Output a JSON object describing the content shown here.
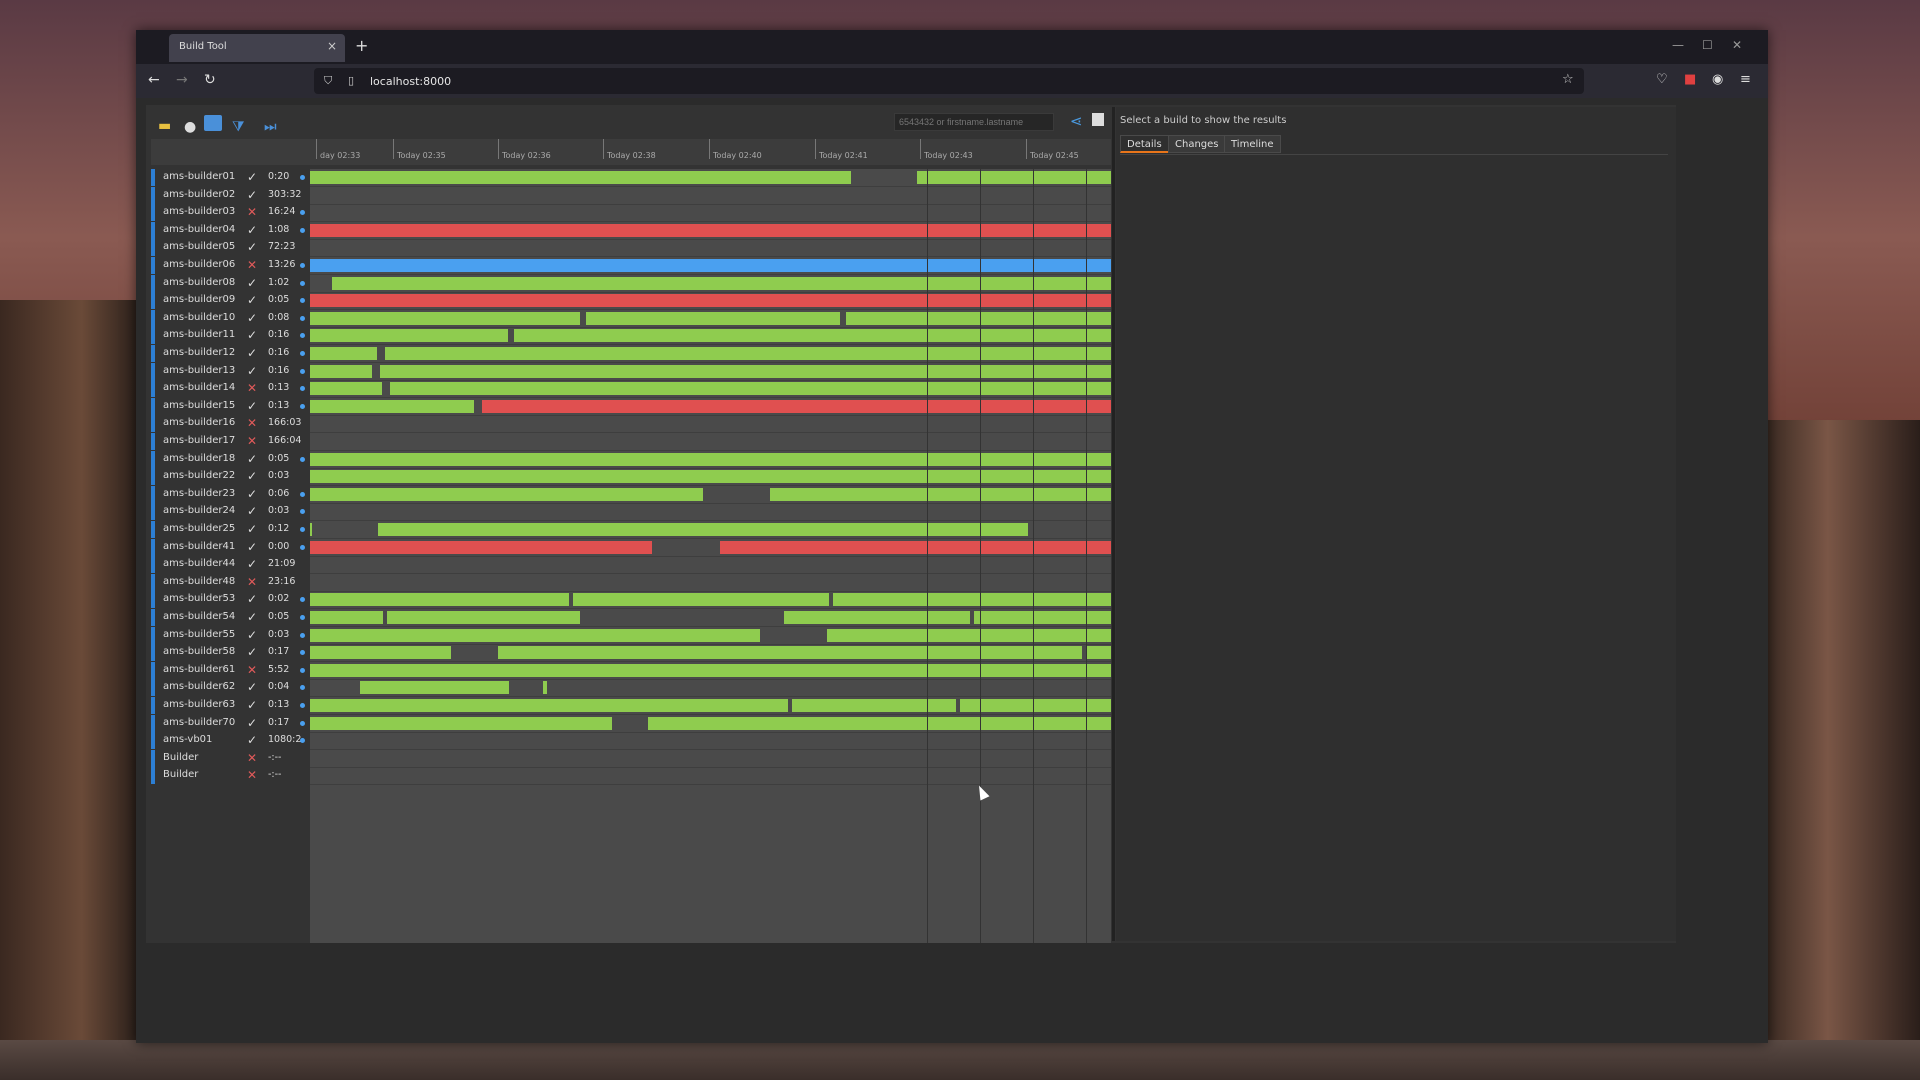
{
  "browser": {
    "tab_title": "Build Tool",
    "tab_close": "×",
    "new_tab": "+",
    "url": "localhost:8000",
    "back": "←",
    "forward": "→",
    "reload": "↻",
    "minimize": "—",
    "maximize": "☐",
    "close": "✕"
  },
  "toolbar": {
    "search_placeholder": "6543432 or firstname.lastname"
  },
  "timeline": {
    "ticks": [
      "day 02:33",
      "Today 02:35",
      "Today 02:36",
      "Today 02:38",
      "Today 02:40",
      "Today 02:41",
      "Today 02:43",
      "Today 02:45"
    ]
  },
  "builders": [
    {
      "name": "ams-builder01",
      "status": "ok",
      "time": "0:20",
      "dot": true
    },
    {
      "name": "ams-builder02",
      "status": "ok",
      "time": "303:32",
      "dot": false
    },
    {
      "name": "ams-builder03",
      "status": "fail",
      "time": "16:24",
      "dot": true
    },
    {
      "name": "ams-builder04",
      "status": "ok",
      "time": "1:08",
      "dot": true
    },
    {
      "name": "ams-builder05",
      "status": "ok",
      "time": "72:23",
      "dot": false
    },
    {
      "name": "ams-builder06",
      "status": "fail",
      "time": "13:26",
      "dot": true
    },
    {
      "name": "ams-builder08",
      "status": "ok",
      "time": "1:02",
      "dot": true
    },
    {
      "name": "ams-builder09",
      "status": "ok",
      "time": "0:05",
      "dot": true
    },
    {
      "name": "ams-builder10",
      "status": "ok",
      "time": "0:08",
      "dot": true
    },
    {
      "name": "ams-builder11",
      "status": "ok",
      "time": "0:16",
      "dot": true
    },
    {
      "name": "ams-builder12",
      "status": "ok",
      "time": "0:16",
      "dot": true
    },
    {
      "name": "ams-builder13",
      "status": "ok",
      "time": "0:16",
      "dot": true
    },
    {
      "name": "ams-builder14",
      "status": "fail",
      "time": "0:13",
      "dot": true
    },
    {
      "name": "ams-builder15",
      "status": "ok",
      "time": "0:13",
      "dot": true
    },
    {
      "name": "ams-builder16",
      "status": "fail",
      "time": "166:03",
      "dot": false
    },
    {
      "name": "ams-builder17",
      "status": "fail",
      "time": "166:04",
      "dot": false
    },
    {
      "name": "ams-builder18",
      "status": "ok",
      "time": "0:05",
      "dot": true
    },
    {
      "name": "ams-builder22",
      "status": "ok",
      "time": "0:03",
      "dot": false
    },
    {
      "name": "ams-builder23",
      "status": "ok",
      "time": "0:06",
      "dot": true
    },
    {
      "name": "ams-builder24",
      "status": "ok",
      "time": "0:03",
      "dot": true
    },
    {
      "name": "ams-builder25",
      "status": "ok",
      "time": "0:12",
      "dot": true
    },
    {
      "name": "ams-builder41",
      "status": "ok",
      "time": "0:00",
      "dot": true
    },
    {
      "name": "ams-builder44",
      "status": "ok",
      "time": "21:09",
      "dot": false
    },
    {
      "name": "ams-builder48",
      "status": "fail",
      "time": "23:16",
      "dot": false
    },
    {
      "name": "ams-builder53",
      "status": "ok",
      "time": "0:02",
      "dot": true
    },
    {
      "name": "ams-builder54",
      "status": "ok",
      "time": "0:05",
      "dot": true
    },
    {
      "name": "ams-builder55",
      "status": "ok",
      "time": "0:03",
      "dot": true
    },
    {
      "name": "ams-builder58",
      "status": "ok",
      "time": "0:17",
      "dot": true
    },
    {
      "name": "ams-builder61",
      "status": "fail",
      "time": "5:52",
      "dot": true
    },
    {
      "name": "ams-builder62",
      "status": "ok",
      "time": "0:04",
      "dot": true
    },
    {
      "name": "ams-builder63",
      "status": "ok",
      "time": "0:13",
      "dot": true
    },
    {
      "name": "ams-builder70",
      "status": "ok",
      "time": "0:17",
      "dot": true
    },
    {
      "name": "ams-vb01",
      "status": "ok",
      "time": "1080:2",
      "dot": true
    },
    {
      "name": "Builder",
      "status": "fail",
      "time": "-:--",
      "dot": false
    },
    {
      "name": "Builder",
      "status": "fail",
      "time": "-:--",
      "dot": false
    }
  ],
  "right_panel": {
    "title": "Select a build to show the results",
    "tabs": [
      "Details",
      "Changes",
      "Timeline"
    ],
    "active_tab": "Details"
  },
  "colors": {
    "success": "#8fcc4f",
    "failure": "#e05050",
    "running": "#4aa0f0",
    "accent": "#e8751a"
  }
}
